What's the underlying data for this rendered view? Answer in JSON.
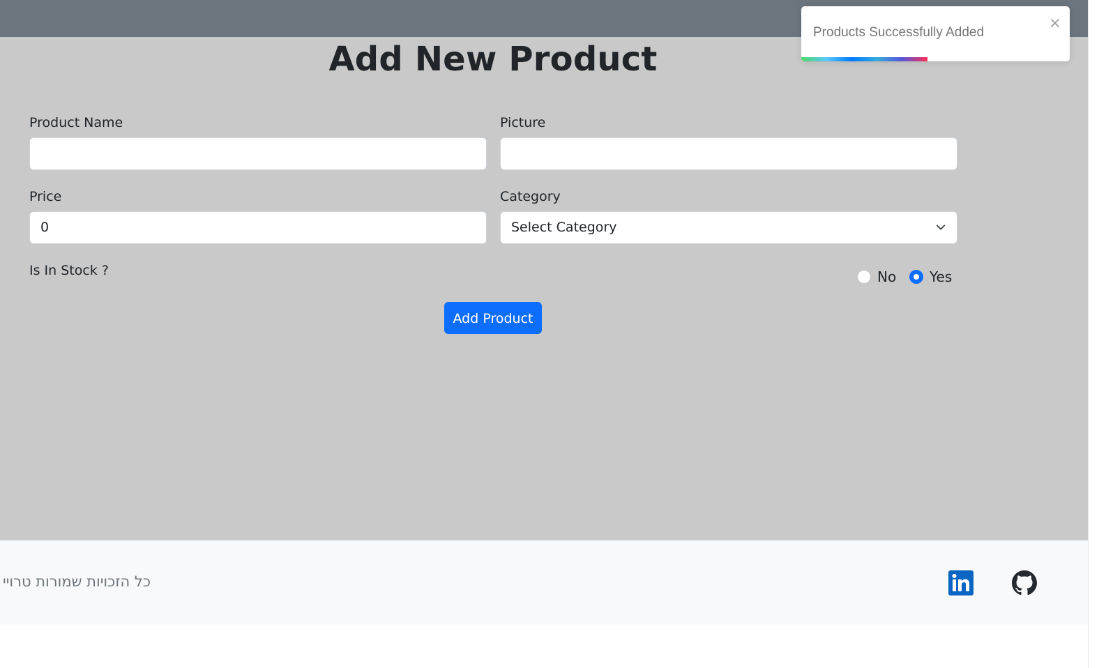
{
  "page": {
    "title": "Add New Product"
  },
  "form": {
    "product_name": {
      "label": "Product Name",
      "value": ""
    },
    "picture": {
      "label": "Picture",
      "value": ""
    },
    "price": {
      "label": "Price",
      "value": "0"
    },
    "category": {
      "label": "Category",
      "value": "Select Category"
    },
    "in_stock": {
      "label": "Is In Stock ?",
      "options": [
        {
          "label": "No",
          "checked": false
        },
        {
          "label": "Yes",
          "checked": true
        }
      ]
    },
    "submit_label": "Add Product"
  },
  "toast": {
    "message": "Products Successfully Added",
    "close_symbol": "×",
    "progress": 0.47
  },
  "footer": {
    "copyright": "כל הזכויות שמורות טרויי",
    "icons": [
      "linkedin-icon",
      "github-icon"
    ]
  },
  "colors": {
    "navbar": "#6c757d",
    "main_bg": "#c9c9c9",
    "primary": "#0d6efd",
    "footer_bg": "#f8f9fa",
    "linkedin": "#0a66c2",
    "github": "#24292f"
  }
}
